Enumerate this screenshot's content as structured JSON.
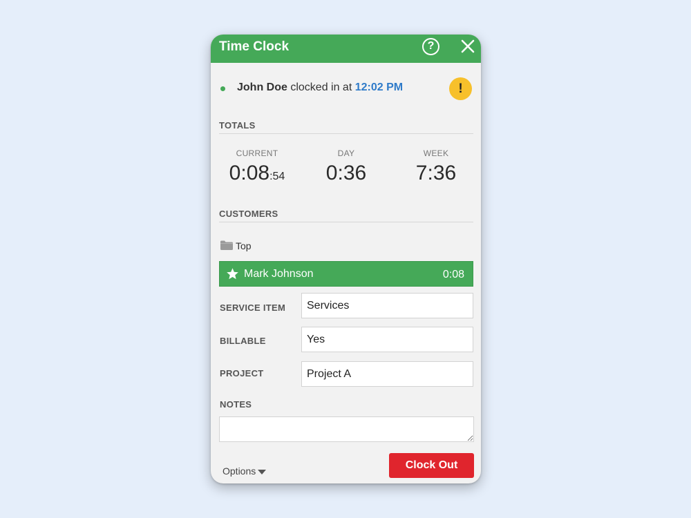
{
  "window": {
    "title": "Time Clock"
  },
  "header_buttons": {
    "help_glyph": "?"
  },
  "status": {
    "name": "John Doe",
    "text": " clocked in at ",
    "time": "12:02 PM",
    "warning_glyph": "!"
  },
  "totals": {
    "section_title": "TOTALS",
    "current": {
      "label": "CURRENT",
      "main": "0:08",
      "seconds": ":54"
    },
    "day": {
      "label": "DAY",
      "value": "0:36"
    },
    "week": {
      "label": "WEEK",
      "value": "7:36"
    }
  },
  "customers": {
    "section_title": "CUSTOMERS",
    "folder": "Top",
    "selected": {
      "name": "Mark Johnson",
      "time": "0:08"
    }
  },
  "fields": {
    "service_item": {
      "label": "SERVICE ITEM",
      "value": "Services"
    },
    "billable": {
      "label": "BILLABLE",
      "value": "Yes"
    },
    "project": {
      "label": "PROJECT",
      "value": "Project A"
    },
    "notes": {
      "label": "NOTES",
      "value": ""
    }
  },
  "footer": {
    "options_label": "Options",
    "clock_out_label": "Clock Out"
  },
  "colors": {
    "accent_green": "#45a958",
    "time_blue": "#2f7bc9",
    "warning_yellow": "#f7c02b",
    "danger_red": "#e0252d"
  },
  "icons": [
    "help-icon",
    "close-icon",
    "status-dot-icon",
    "warning-icon",
    "folder-icon",
    "star-icon",
    "caret-down-icon"
  ]
}
